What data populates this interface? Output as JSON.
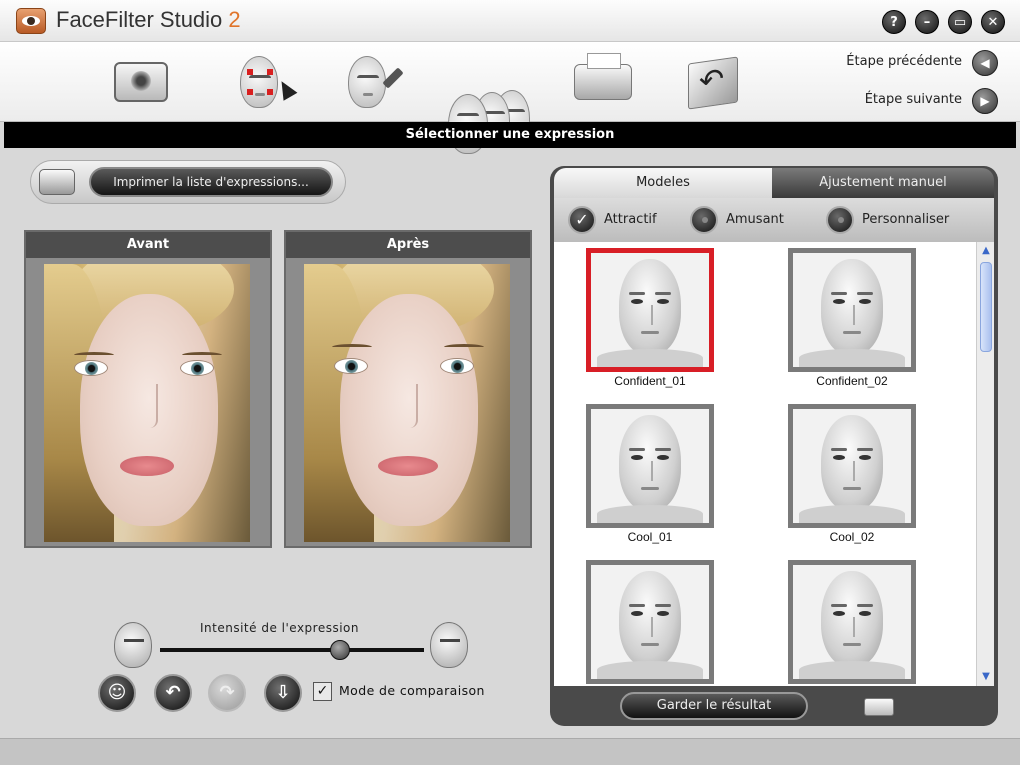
{
  "window": {
    "title": "FaceFilter Studio",
    "version": "2",
    "controls": [
      "?",
      "–",
      "▭",
      "✕"
    ]
  },
  "toolbar": {
    "steps": [
      "camera-icon",
      "face-select-icon",
      "face-edit-icon",
      "face-expressions-icon",
      "printer-icon",
      "export-folder-icon"
    ],
    "prev_label": "Étape précédente",
    "next_label": "Étape suivante"
  },
  "section_title": "Sélectionner une expression",
  "left": {
    "print_list_label": "Imprimer la liste d'expressions...",
    "before_label": "Avant",
    "after_label": "Après",
    "intensity_label": "Intensité de l'expression",
    "intensity_value": 0.68,
    "compare_label": "Mode de comparaison",
    "compare_checked": true,
    "check_glyph": "✓",
    "action_buttons": [
      {
        "name": "face-reset-button",
        "glyph": "☺",
        "enabled": true
      },
      {
        "name": "undo-button",
        "glyph": "↶",
        "enabled": true
      },
      {
        "name": "redo-button",
        "glyph": "↷",
        "enabled": false
      },
      {
        "name": "save-button",
        "glyph": "⇩",
        "enabled": true
      }
    ]
  },
  "right": {
    "tabs": [
      {
        "label": "Modeles",
        "active": true
      },
      {
        "label": "Ajustement manuel",
        "active": false
      }
    ],
    "categories": [
      {
        "label": "Attractif",
        "selected": true
      },
      {
        "label": "Amusant",
        "selected": false
      },
      {
        "label": "Personnaliser",
        "selected": false
      }
    ],
    "thumbnails": [
      {
        "name": "Confident_01",
        "selected": true
      },
      {
        "name": "Confident_02",
        "selected": false
      },
      {
        "name": "Cool_01",
        "selected": false
      },
      {
        "name": "Cool_02",
        "selected": false
      },
      {
        "name": "",
        "selected": false
      },
      {
        "name": "",
        "selected": false
      }
    ],
    "keep_label": "Garder le résultat"
  },
  "colors": {
    "accent_version": "#e0742a",
    "selection": "#d81e26",
    "section_bar": "#000000"
  }
}
